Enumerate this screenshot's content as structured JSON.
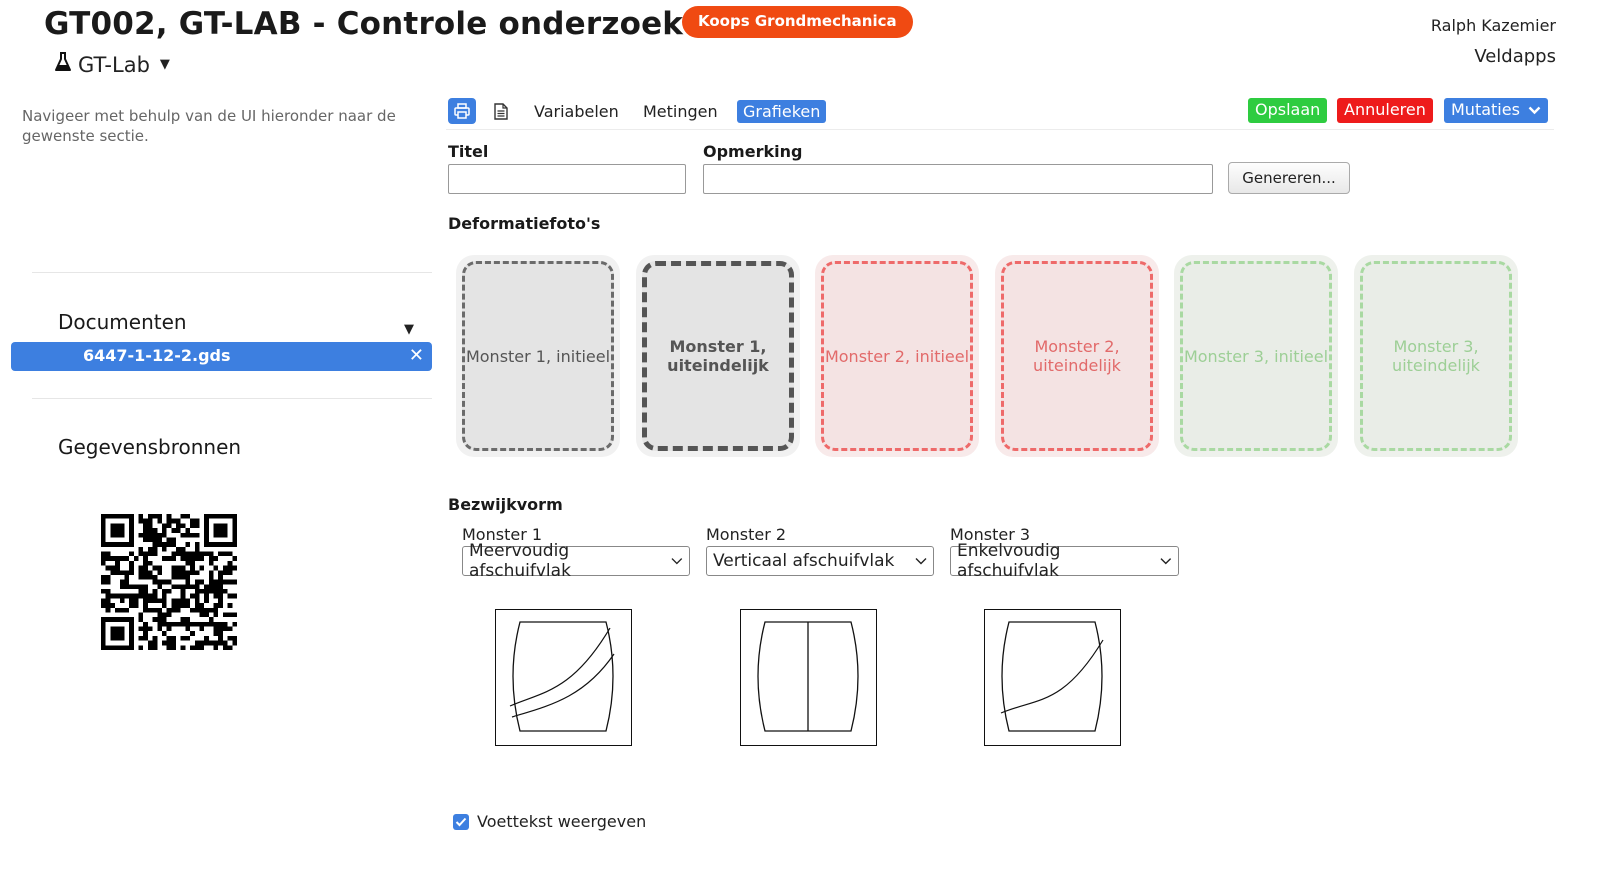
{
  "header": {
    "title": "GT002, GT-LAB - Controle onderzoek",
    "company": "Koops Grondmechanica",
    "app_switch": "GT-Lab",
    "user_name": "Ralph Kazemier",
    "user_app": "Veldapps"
  },
  "sidebar": {
    "hint": "Navigeer met behulp van de UI hieronder naar de gewenste sectie.",
    "documents_title": "Documenten",
    "document": "6447-1-12-2.gds",
    "sources_title": "Gegevensbronnen"
  },
  "toolbar": {
    "variables": "Variabelen",
    "measurements": "Metingen",
    "charts": "Grafieken",
    "save": "Opslaan",
    "cancel": "Annuleren",
    "mutations": "Mutaties"
  },
  "form": {
    "title_label": "Titel",
    "title_value": "",
    "remark_label": "Opmerking",
    "remark_value": "",
    "generate": "Genereren..."
  },
  "photos": {
    "section": "Deformatiefoto's",
    "items": [
      "Monster 1, initieel",
      "Monster 1, uiteindelijk",
      "Monster 2, initieel",
      "Monster 2, uiteindelijk",
      "Monster 3, initieel",
      "Monster 3, uiteindelijk"
    ]
  },
  "failure": {
    "section": "Bezwijkvorm",
    "samples": [
      {
        "label": "Monster 1",
        "value": "Meervoudig afschuifvlak"
      },
      {
        "label": "Monster 2",
        "value": "Verticaal afschuifvlak"
      },
      {
        "label": "Monster 3",
        "value": "Enkelvoudig afschuifvlak"
      }
    ]
  },
  "footer": {
    "show_footer": "Voettekst weergeven",
    "checked": true
  },
  "colors": {
    "accent": "#3d7fe0",
    "badge": "#f04a12",
    "save": "#2ecc40",
    "cancel": "#ee1b1b"
  }
}
